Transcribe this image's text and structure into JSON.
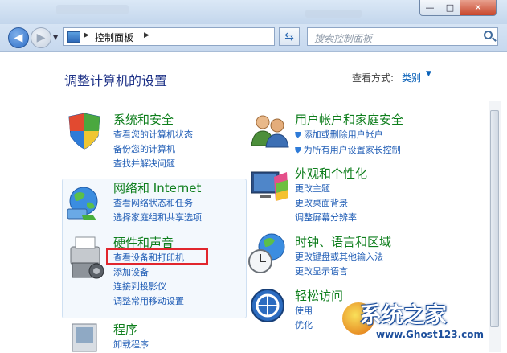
{
  "window": {
    "min_label": "—",
    "max_label": "□",
    "close_label": "✕"
  },
  "nav": {
    "back_glyph": "◀",
    "forward_glyph": "▶",
    "dropdown_glyph": "▼",
    "refresh_glyph": "⇆"
  },
  "address": {
    "separator": "▶",
    "location": "控制面板",
    "separator2": "▶",
    "dropdown": "▼"
  },
  "search": {
    "placeholder": "搜索控制面板"
  },
  "main": {
    "heading": "调整计算机的设置",
    "view_by_label": "查看方式:",
    "view_by_value": "类别",
    "view_by_arrow": "▼"
  },
  "categories": [
    {
      "title": "系统和安全",
      "icon": "shield-icon",
      "links": [
        "查看您的计算机状态",
        "备份您的计算机",
        "查找并解决问题"
      ]
    },
    {
      "title": "网络和 Internet",
      "icon": "network-globe-icon",
      "links": [
        "查看网络状态和任务",
        "选择家庭组和共享选项"
      ]
    },
    {
      "title": "硬件和声音",
      "icon": "printer-icon",
      "links": [
        "查看设备和打印机",
        "添加设备",
        "连接到投影仪",
        "调整常用移动设置"
      ]
    },
    {
      "title": "程序",
      "icon": "programs-icon",
      "links": [
        "卸载程序"
      ]
    },
    {
      "title": "用户帐户和家庭安全",
      "icon": "users-icon",
      "links": [
        "添加或删除用户帐户",
        "为所有用户设置家长控制"
      ]
    },
    {
      "title": "外观和个性化",
      "icon": "monitor-icon",
      "links": [
        "更改主题",
        "更改桌面背景",
        "调整屏幕分辨率"
      ]
    },
    {
      "title": "时钟、语言和区域",
      "icon": "clock-globe-icon",
      "links": [
        "更改键盘或其他输入法",
        "更改显示语言"
      ]
    },
    {
      "title": "轻松访问",
      "icon": "ease-of-access-icon",
      "links": [
        "使用",
        "优化"
      ]
    }
  ],
  "watermark": {
    "text": "系统之家",
    "url": "www.Ghost123.com"
  }
}
